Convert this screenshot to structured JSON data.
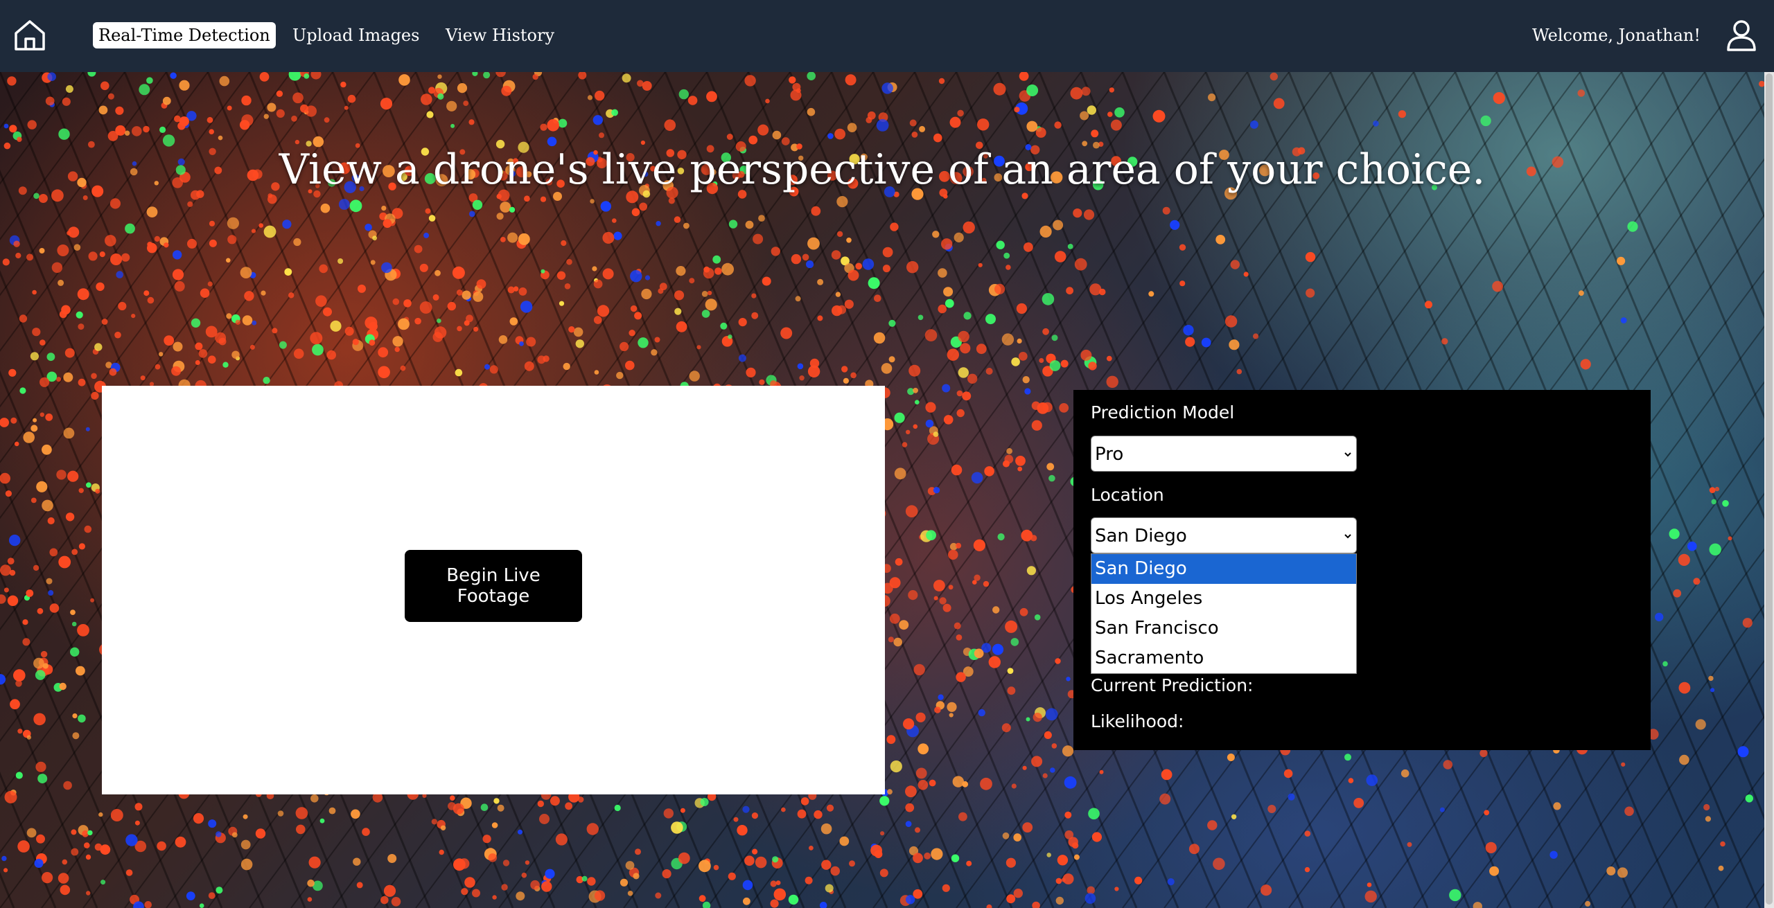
{
  "nav": {
    "home_icon": "home-icon",
    "links": [
      {
        "label": "Real-Time Detection",
        "active": true
      },
      {
        "label": "Upload Images",
        "active": false
      },
      {
        "label": "View History",
        "active": false
      }
    ],
    "welcome": "Welcome, Jonathan!",
    "user_icon": "user-icon"
  },
  "hero": {
    "title": "View a drone's live perspective of an area of your choice."
  },
  "video": {
    "begin_label": "Begin Live Footage"
  },
  "controls": {
    "model_label": "Prediction Model",
    "model_value": "Pro",
    "location_label": "Location",
    "location_value": "San Diego",
    "location_options": [
      "San Diego",
      "Los Angeles",
      "San Francisco",
      "Sacramento"
    ],
    "current_prediction_label": "Current Prediction:",
    "likelihood_label": "Likelihood:"
  },
  "colors": {
    "navbar": "#1e2a3a",
    "selected_option": "#1a66d2",
    "panel": "#000000"
  }
}
